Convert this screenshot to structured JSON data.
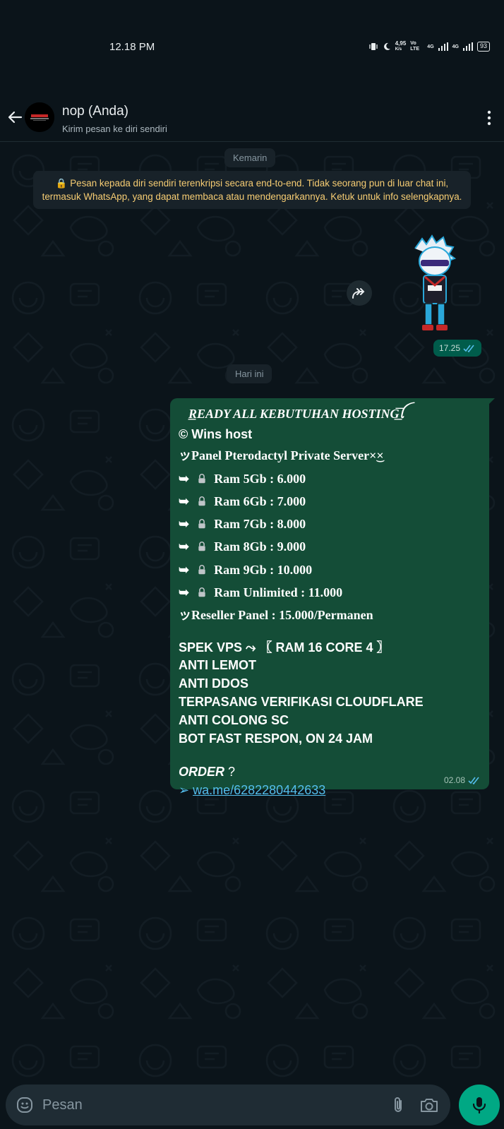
{
  "status_bar": {
    "time": "12.18 PM",
    "net_speed": "4,95",
    "net_unit": "K/s",
    "vo_lte": "Vo LTE",
    "net1": "4G",
    "net2": "4G",
    "battery": "93"
  },
  "header": {
    "name": "nop (Anda)",
    "subtitle": "Kirim pesan ke diri sendiri"
  },
  "chat": {
    "date_yesterday": "Kemarin",
    "e2e_notice": "🔒 Pesan kepada diri sendiri terenkripsi secara end-to-end. Tidak seorang pun di luar chat ini, termasuk WhatsApp, yang dapat membaca atau mendengarkannya. Ketuk untuk info selengkapnya.",
    "sticker_time": "17.25",
    "date_today": "Hari ini",
    "message": {
      "title": "ᅳ͟READY ALL KEBUTUHAN HOSTING͟͞ꪶ",
      "brand": "© Wins host",
      "panel_heading": "ッPanel Pterodactyl Private Server×͜×",
      "arrow": "➥",
      "plans": [
        "Ram 5Gb : 6.000",
        "Ram 6Gb : 7.000",
        "Ram 7Gb : 8.000",
        "Ram 8Gb : 9.000",
        "Ram 9Gb : 10.000",
        "Ram Unlimited : 11.000"
      ],
      "reseller": "ッReseller Panel : 15.000/Permanen",
      "spek": "SPEK VPS ⤳ 〖 RAM 16 CORE 4 〗",
      "features": [
        "ANTI LEMOT",
        "ANTI DDOS",
        "TERPASANG VERIFIKASI CLOUDFLARE",
        "ANTI COLONG SC",
        "BOT FAST RESPON, ON 24 JAM"
      ],
      "order_label": "ORDER",
      "order_q": " ?",
      "link_arrow": "➢ ",
      "link": "wa.me/6282280442633",
      "time": "02.08"
    }
  },
  "input": {
    "placeholder": "Pesan"
  },
  "colors": {
    "background": "#0b141a",
    "bubble_out": "#144d37",
    "accent": "#00a884",
    "link": "#53bdeb",
    "read_tick": "#53bdeb",
    "notice_text": "#f7cd73"
  },
  "icons": [
    "back-arrow-icon",
    "more-vert-icon",
    "forward-icon",
    "read-ticks-icon",
    "emoji-icon",
    "attach-icon",
    "camera-icon",
    "mic-icon",
    "lock-icon"
  ]
}
